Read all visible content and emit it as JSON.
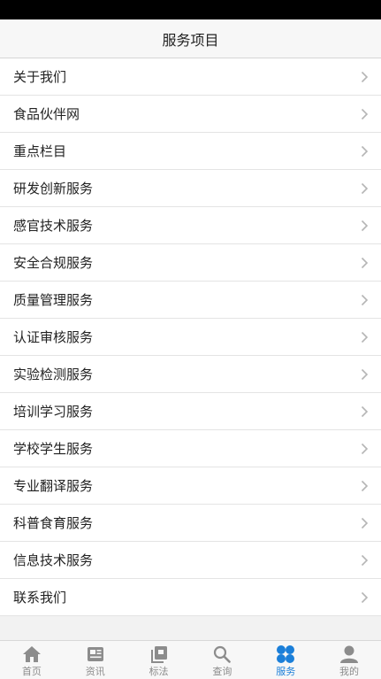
{
  "header": {
    "title": "服务项目"
  },
  "list": {
    "items": [
      {
        "label": "关于我们"
      },
      {
        "label": "食品伙伴网"
      },
      {
        "label": "重点栏目"
      },
      {
        "label": "研发创新服务"
      },
      {
        "label": "感官技术服务"
      },
      {
        "label": "安全合规服务"
      },
      {
        "label": "质量管理服务"
      },
      {
        "label": "认证审核服务"
      },
      {
        "label": "实验检测服务"
      },
      {
        "label": "培训学习服务"
      },
      {
        "label": "学校学生服务"
      },
      {
        "label": "专业翻译服务"
      },
      {
        "label": "科普食育服务"
      },
      {
        "label": "信息技术服务"
      },
      {
        "label": "联系我们"
      }
    ],
    "chevron_icon": "chevron-right-icon"
  },
  "tabbar": {
    "tabs": [
      {
        "label": "首页",
        "icon": "home-icon",
        "active": false
      },
      {
        "label": "资讯",
        "icon": "news-icon",
        "active": false
      },
      {
        "label": "标法",
        "icon": "standards-icon",
        "active": false
      },
      {
        "label": "查询",
        "icon": "search-icon",
        "active": false
      },
      {
        "label": "服务",
        "icon": "services-icon",
        "active": true
      },
      {
        "label": "我的",
        "icon": "profile-icon",
        "active": false
      }
    ]
  },
  "colors": {
    "accent": "#1b7fd9",
    "inactive": "#8c8c8c"
  }
}
